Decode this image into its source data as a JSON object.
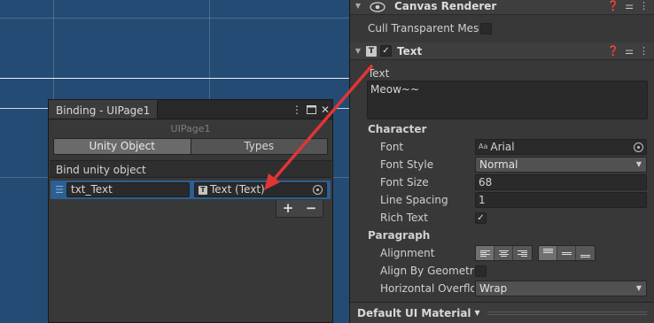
{
  "scene": {},
  "binding_window": {
    "tab_title": "Binding - UIPage1",
    "subtitle": "UIPage1",
    "tabs": [
      "Unity Object",
      "Types"
    ],
    "active_tab": "Unity Object",
    "section_label": "Bind unity object",
    "row": {
      "name_value": "txt_Text",
      "object_value": "Text (Text)"
    },
    "add_label": "+",
    "remove_label": "−"
  },
  "inspector": {
    "canvas_renderer": {
      "title": "Canvas Renderer",
      "cull_label": "Cull Transparent Mes",
      "cull_checked": false
    },
    "text_component": {
      "title": "Text",
      "enabled": true,
      "text_label": "Text",
      "text_value": "Meow~~",
      "character_label": "Character",
      "font_label": "Font",
      "font_value": "Arial",
      "font_style_label": "Font Style",
      "font_style_value": "Normal",
      "font_size_label": "Font Size",
      "font_size_value": "68",
      "line_spacing_label": "Line Spacing",
      "line_spacing_value": "1",
      "rich_text_label": "Rich Text",
      "rich_text_checked": true,
      "paragraph_label": "Paragraph",
      "alignment_label": "Alignment",
      "align_by_geometry_label": "Align By Geometry",
      "align_by_geometry_checked": false,
      "horizontal_overflow_label": "Horizontal Overflo",
      "horizontal_overflow_value": "Wrap"
    },
    "material_label": "Default UI Material"
  },
  "colors": {
    "scene_bg": "#244b73",
    "panel_bg": "#383838",
    "selection": "#2b5f95",
    "arrow": "#e03535"
  }
}
